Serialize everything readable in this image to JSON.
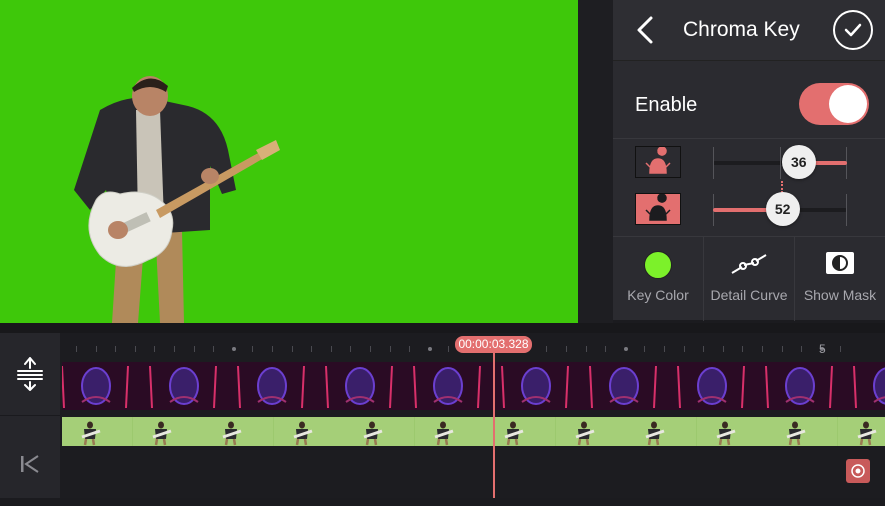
{
  "panel": {
    "title": "Chroma Key",
    "enable_label": "Enable",
    "enable_on": true,
    "slider1": {
      "value": "36",
      "fraction": 0.64
    },
    "slider2": {
      "value": "52",
      "fraction": 0.52
    },
    "tools": [
      {
        "label": "Key Color",
        "icon": "key-color-icon"
      },
      {
        "label": "Detail Curve",
        "icon": "detail-curve-icon"
      },
      {
        "label": "Show Mask",
        "icon": "show-mask-icon"
      }
    ]
  },
  "timeline": {
    "current_time": "00:00:03.328",
    "ruler_marker": "5"
  },
  "colors": {
    "accent": "#e36f6f",
    "chroma_green": "#3ec80a",
    "key_color": "#7cf12a"
  }
}
